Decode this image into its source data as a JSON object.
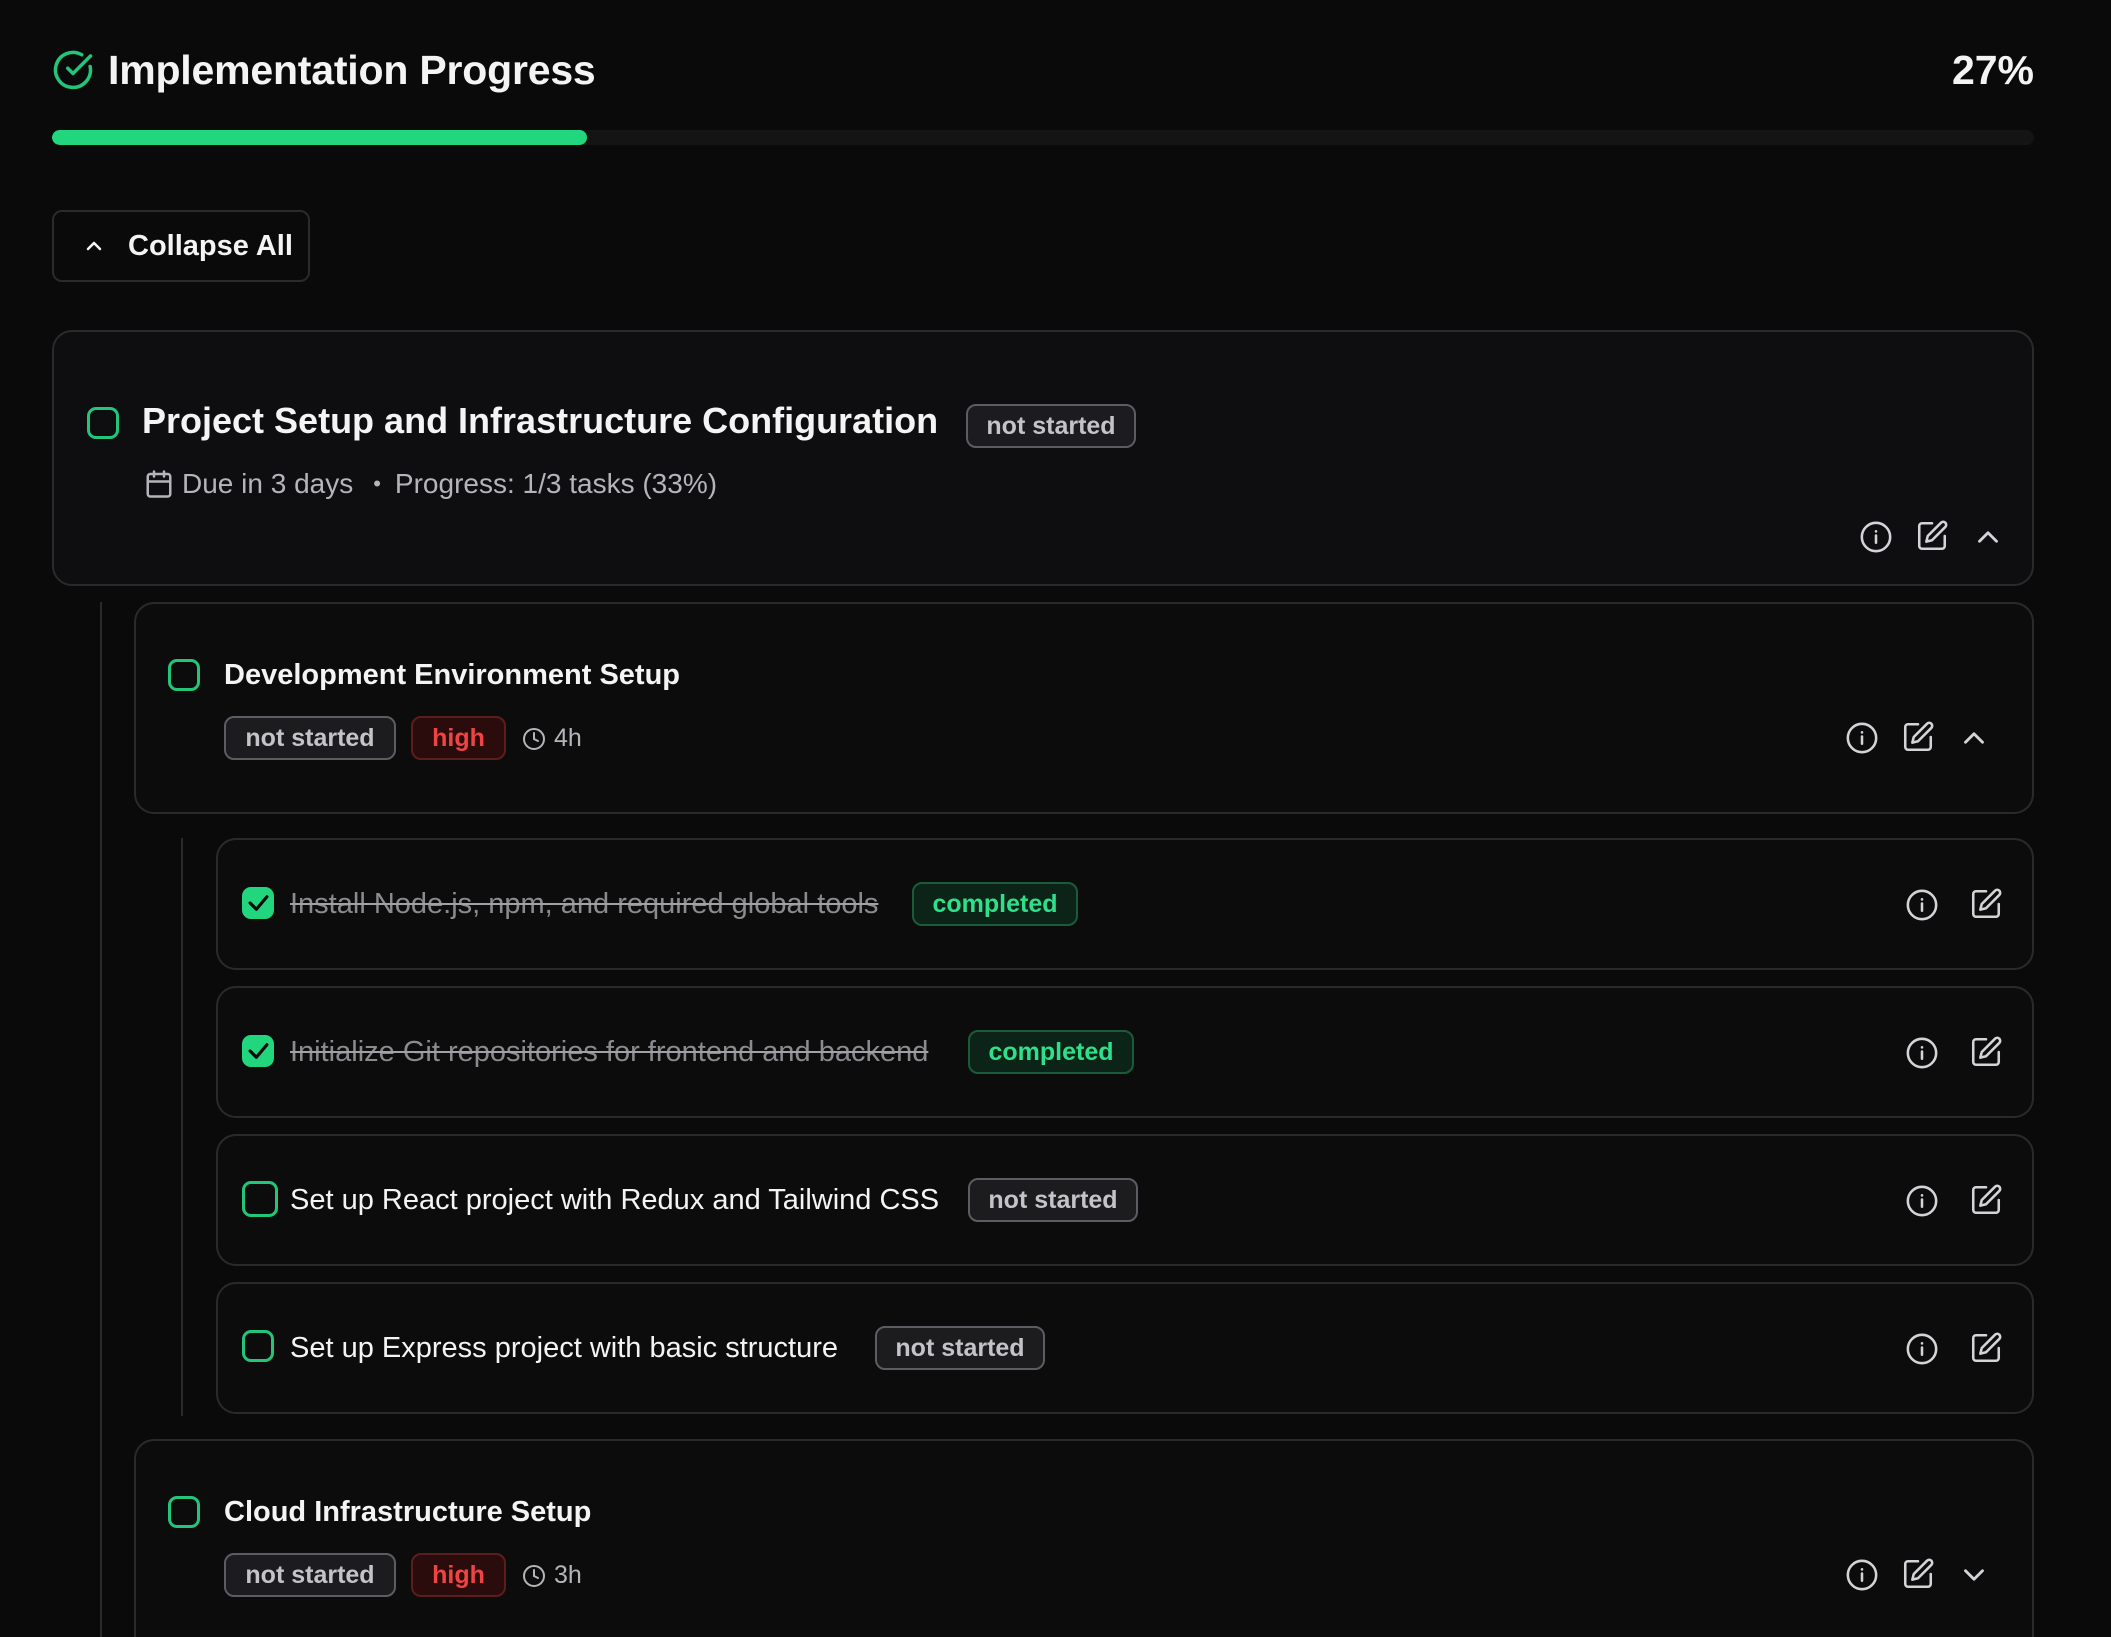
{
  "header": {
    "title": "Implementation Progress",
    "percent_label": "27%",
    "progress_fraction": 0.27,
    "accent": "#22d67e"
  },
  "toolbar": {
    "collapse_label": "Collapse All"
  },
  "phase": {
    "title": "Project Setup and Infrastructure Configuration",
    "status": "not started",
    "due": "Due in 3 days",
    "progress": "Progress: 1/3 tasks (33%)"
  },
  "groups": [
    {
      "title": "Development Environment Setup",
      "status": "not started",
      "priority": "high",
      "estimate": "4h",
      "tasks": [
        {
          "title": "Install Node.js, npm, and required global tools",
          "status": "completed",
          "done": true
        },
        {
          "title": "Initialize Git repositories for frontend and backend",
          "status": "completed",
          "done": true
        },
        {
          "title": "Set up React project with Redux and Tailwind CSS",
          "status": "not started",
          "done": false
        },
        {
          "title": "Set up Express project with basic structure",
          "status": "not started",
          "done": false
        }
      ]
    },
    {
      "title": "Cloud Infrastructure Setup",
      "status": "not started",
      "priority": "high",
      "estimate": "3h"
    }
  ],
  "icons": {
    "header": "check-circle-icon",
    "collapse": "chevron-up-icon",
    "due": "calendar-icon",
    "estimate": "clock-icon",
    "info": "info-icon",
    "edit": "edit-icon",
    "expand": "chevron-up-icon",
    "collapsed": "chevron-down-icon",
    "done": "checkmark-icon"
  },
  "colors": {
    "completed": "#2fe08a",
    "high": "#f04444",
    "not_started": "#c4c4c8"
  }
}
